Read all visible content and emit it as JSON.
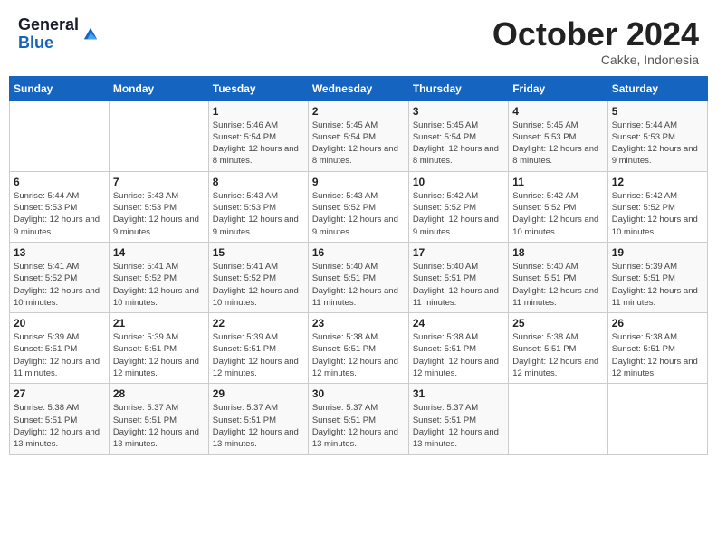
{
  "header": {
    "logo_line1": "General",
    "logo_line2": "Blue",
    "month_title": "October 2024",
    "location": "Cakke, Indonesia"
  },
  "weekdays": [
    "Sunday",
    "Monday",
    "Tuesday",
    "Wednesday",
    "Thursday",
    "Friday",
    "Saturday"
  ],
  "weeks": [
    [
      {
        "day": "",
        "info": ""
      },
      {
        "day": "",
        "info": ""
      },
      {
        "day": "1",
        "info": "Sunrise: 5:46 AM\nSunset: 5:54 PM\nDaylight: 12 hours and 8 minutes."
      },
      {
        "day": "2",
        "info": "Sunrise: 5:45 AM\nSunset: 5:54 PM\nDaylight: 12 hours and 8 minutes."
      },
      {
        "day": "3",
        "info": "Sunrise: 5:45 AM\nSunset: 5:54 PM\nDaylight: 12 hours and 8 minutes."
      },
      {
        "day": "4",
        "info": "Sunrise: 5:45 AM\nSunset: 5:53 PM\nDaylight: 12 hours and 8 minutes."
      },
      {
        "day": "5",
        "info": "Sunrise: 5:44 AM\nSunset: 5:53 PM\nDaylight: 12 hours and 9 minutes."
      }
    ],
    [
      {
        "day": "6",
        "info": "Sunrise: 5:44 AM\nSunset: 5:53 PM\nDaylight: 12 hours and 9 minutes."
      },
      {
        "day": "7",
        "info": "Sunrise: 5:43 AM\nSunset: 5:53 PM\nDaylight: 12 hours and 9 minutes."
      },
      {
        "day": "8",
        "info": "Sunrise: 5:43 AM\nSunset: 5:53 PM\nDaylight: 12 hours and 9 minutes."
      },
      {
        "day": "9",
        "info": "Sunrise: 5:43 AM\nSunset: 5:52 PM\nDaylight: 12 hours and 9 minutes."
      },
      {
        "day": "10",
        "info": "Sunrise: 5:42 AM\nSunset: 5:52 PM\nDaylight: 12 hours and 9 minutes."
      },
      {
        "day": "11",
        "info": "Sunrise: 5:42 AM\nSunset: 5:52 PM\nDaylight: 12 hours and 10 minutes."
      },
      {
        "day": "12",
        "info": "Sunrise: 5:42 AM\nSunset: 5:52 PM\nDaylight: 12 hours and 10 minutes."
      }
    ],
    [
      {
        "day": "13",
        "info": "Sunrise: 5:41 AM\nSunset: 5:52 PM\nDaylight: 12 hours and 10 minutes."
      },
      {
        "day": "14",
        "info": "Sunrise: 5:41 AM\nSunset: 5:52 PM\nDaylight: 12 hours and 10 minutes."
      },
      {
        "day": "15",
        "info": "Sunrise: 5:41 AM\nSunset: 5:52 PM\nDaylight: 12 hours and 10 minutes."
      },
      {
        "day": "16",
        "info": "Sunrise: 5:40 AM\nSunset: 5:51 PM\nDaylight: 12 hours and 11 minutes."
      },
      {
        "day": "17",
        "info": "Sunrise: 5:40 AM\nSunset: 5:51 PM\nDaylight: 12 hours and 11 minutes."
      },
      {
        "day": "18",
        "info": "Sunrise: 5:40 AM\nSunset: 5:51 PM\nDaylight: 12 hours and 11 minutes."
      },
      {
        "day": "19",
        "info": "Sunrise: 5:39 AM\nSunset: 5:51 PM\nDaylight: 12 hours and 11 minutes."
      }
    ],
    [
      {
        "day": "20",
        "info": "Sunrise: 5:39 AM\nSunset: 5:51 PM\nDaylight: 12 hours and 11 minutes."
      },
      {
        "day": "21",
        "info": "Sunrise: 5:39 AM\nSunset: 5:51 PM\nDaylight: 12 hours and 12 minutes."
      },
      {
        "day": "22",
        "info": "Sunrise: 5:39 AM\nSunset: 5:51 PM\nDaylight: 12 hours and 12 minutes."
      },
      {
        "day": "23",
        "info": "Sunrise: 5:38 AM\nSunset: 5:51 PM\nDaylight: 12 hours and 12 minutes."
      },
      {
        "day": "24",
        "info": "Sunrise: 5:38 AM\nSunset: 5:51 PM\nDaylight: 12 hours and 12 minutes."
      },
      {
        "day": "25",
        "info": "Sunrise: 5:38 AM\nSunset: 5:51 PM\nDaylight: 12 hours and 12 minutes."
      },
      {
        "day": "26",
        "info": "Sunrise: 5:38 AM\nSunset: 5:51 PM\nDaylight: 12 hours and 12 minutes."
      }
    ],
    [
      {
        "day": "27",
        "info": "Sunrise: 5:38 AM\nSunset: 5:51 PM\nDaylight: 12 hours and 13 minutes."
      },
      {
        "day": "28",
        "info": "Sunrise: 5:37 AM\nSunset: 5:51 PM\nDaylight: 12 hours and 13 minutes."
      },
      {
        "day": "29",
        "info": "Sunrise: 5:37 AM\nSunset: 5:51 PM\nDaylight: 12 hours and 13 minutes."
      },
      {
        "day": "30",
        "info": "Sunrise: 5:37 AM\nSunset: 5:51 PM\nDaylight: 12 hours and 13 minutes."
      },
      {
        "day": "31",
        "info": "Sunrise: 5:37 AM\nSunset: 5:51 PM\nDaylight: 12 hours and 13 minutes."
      },
      {
        "day": "",
        "info": ""
      },
      {
        "day": "",
        "info": ""
      }
    ]
  ]
}
